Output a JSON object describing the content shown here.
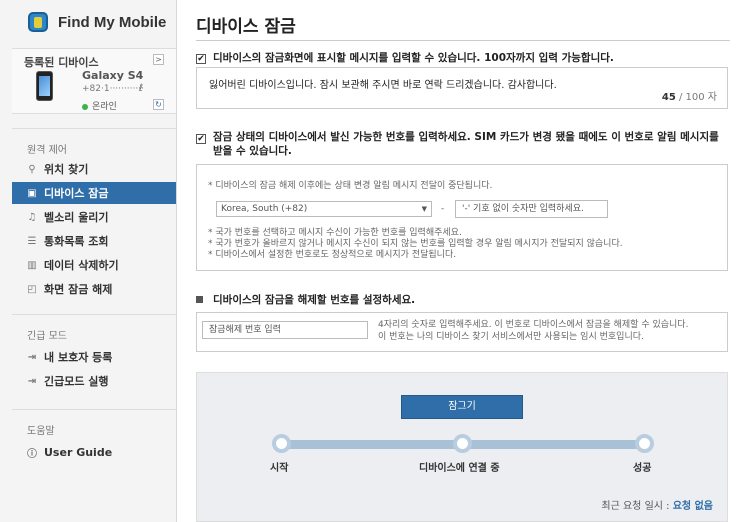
{
  "app": {
    "name": "Find My Mobile"
  },
  "device": {
    "header": "등록된 디바이스",
    "header_arrow": ">",
    "model": "Galaxy S4",
    "number": "+82·1············",
    "edit_icon": "ℓ",
    "status": "온라인",
    "refresh_icon": "↻"
  },
  "sections": {
    "remote": "원격 제어",
    "emergency": "긴급 모드",
    "help": "도움말"
  },
  "nav": {
    "locate": "위치 찾기",
    "lock": "디바이스 잠금",
    "ring": "벨소리 울리기",
    "call_log": "통화목록 조회",
    "wipe": "데이터 삭제하기",
    "unlock": "화면 잠금 해제",
    "guardian": "내 보호자 등록",
    "emergency_run": "긴급모드 실행",
    "user_guide": "User Guide"
  },
  "main": {
    "title": "디바이스 잠금",
    "q1": "디바이스의 잠금화면에 표시할 메시지를 입력할 수 있습니다. 100자까지 입력 가능합니다.",
    "message": "잃어버린 디바이스입니다. 잠시 보관해 주시면 바로 연락 드리겠습니다. 감사합니다.",
    "count_current": "45",
    "count_total": "/ 100 자",
    "q2_line1": "잠금 상태의 디바이스에서 발신 가능한 번호를 입력하세요. SIM 카드가 변경 됐을 때에도 이 번호로 알림 메시지를",
    "q2_line2": "받을 수 있습니다.",
    "q2_note": "* 디바이스의 잠금 해제 이후에는 상태 변경 알림 메시지 전달이 중단됩니다.",
    "country": "Korea, South (+82)",
    "country_arrow": "▼",
    "dash": "-",
    "phone_placeholder": "'-' 기호 없이 숫자만 입력하세요.",
    "q2_hint1": "* 국가 번호를 선택하고 메시지 수신이 가능한 번호를 입력해주세요.",
    "q2_hint2": "* 국가 번호가 올바르지 않거나 메시지 수신이 되지 않는 번호를 입력할 경우 알림 메시지가 전달되지 않습니다.",
    "q2_hint3": "* 디바이스에서 설정한 번호로도 정상적으로 메시지가 전달됩니다.",
    "q3": "디바이스의 잠금을 해제할 번호를 설정하세요.",
    "pin_placeholder": "잠금해제 번호 입력",
    "q3_note1": "4자리의 숫자로 입력해주세요. 이 번호로 디바이스에서 잠금을 해제할 수 있습니다.",
    "q3_note2": "이 번호는 나의 디바이스 찾기 서비스에서만 사용되는 임시 번호입니다.",
    "lock_button": "잠그기",
    "step_start": "시작",
    "step_connect": "디바이스에 연결 중",
    "step_success": "성공",
    "last_request_label": "최근 요청 일시 :",
    "last_request_value": "요청 없음"
  },
  "icons": {
    "locate": "search-icon",
    "lock": "lock-icon",
    "ring": "music-note-icon",
    "call_log": "list-icon",
    "wipe": "trash-icon",
    "unlock": "unlock-icon",
    "guardian": "login-icon",
    "emergency_run": "login-icon",
    "user_guide": "info-icon"
  },
  "colors": {
    "accent": "#2f6ea8",
    "online": "#3bb34a"
  }
}
